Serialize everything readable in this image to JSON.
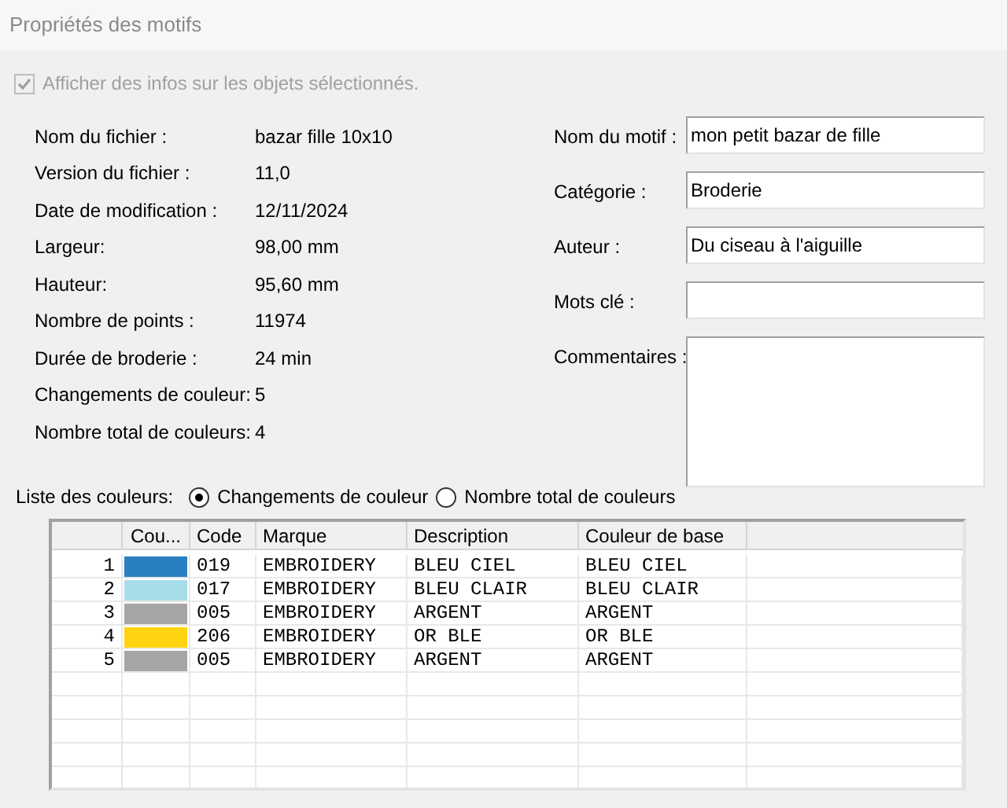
{
  "window": {
    "title": "Propriétés des motifs"
  },
  "show_info": {
    "label": "Afficher des infos sur les objets sélectionnés.",
    "checked": true,
    "disabled": true
  },
  "info": [
    {
      "label": "Nom du fichier :",
      "value": "bazar fille 10x10"
    },
    {
      "label": "Version du fichier :",
      "value": "11,0"
    },
    {
      "label": "Date de modification :",
      "value": "12/11/2024"
    },
    {
      "label": "Largeur:",
      "value": "98,00 mm"
    },
    {
      "label": "Hauteur:",
      "value": "95,60 mm"
    },
    {
      "label": "Nombre de points :",
      "value": "11974"
    },
    {
      "label": "Durée de broderie :",
      "value": "24 min"
    },
    {
      "label": "Changements de couleur:",
      "value": "5"
    },
    {
      "label": "Nombre total de couleurs:",
      "value": "4"
    }
  ],
  "fields": [
    {
      "label": "Nom du motif :",
      "value": "mon petit bazar de fille",
      "kind": "line"
    },
    {
      "label": "Catégorie :",
      "value": "Broderie",
      "kind": "line"
    },
    {
      "label": "Auteur :",
      "value": "Du ciseau à l'aiguille",
      "kind": "line"
    },
    {
      "label": "Mots clé :",
      "kind": "line"
    },
    {
      "label": "Commentaires :",
      "kind": "area"
    }
  ],
  "color_list": {
    "label": "Liste des couleurs:",
    "options": [
      {
        "label": "Changements de couleur",
        "selected": true
      },
      {
        "label": "Nombre total de couleurs",
        "selected": false
      }
    ]
  },
  "table": {
    "columns": [
      "Cou...",
      "Code",
      "Marque",
      "Description",
      "Couleur de base"
    ],
    "rows": [
      {
        "index": "1",
        "color": "#2a7fc0",
        "code": "019",
        "brand": "EMBROIDERY",
        "description": "BLEU CIEL",
        "base": "BLEU CIEL"
      },
      {
        "index": "2",
        "color": "#a8dce9",
        "code": "017",
        "brand": "EMBROIDERY",
        "description": "BLEU CLAIR",
        "base": "BLEU CLAIR"
      },
      {
        "index": "3",
        "color": "#a5a5a5",
        "code": "005",
        "brand": "EMBROIDERY",
        "description": "ARGENT",
        "base": "ARGENT"
      },
      {
        "index": "4",
        "color": "#ffd30f",
        "code": "206",
        "brand": "EMBROIDERY",
        "description": "OR BLE",
        "base": "OR BLE"
      },
      {
        "index": "5",
        "color": "#a5a5a5",
        "code": "005",
        "brand": "EMBROIDERY",
        "description": "ARGENT",
        "base": "ARGENT"
      }
    ]
  }
}
